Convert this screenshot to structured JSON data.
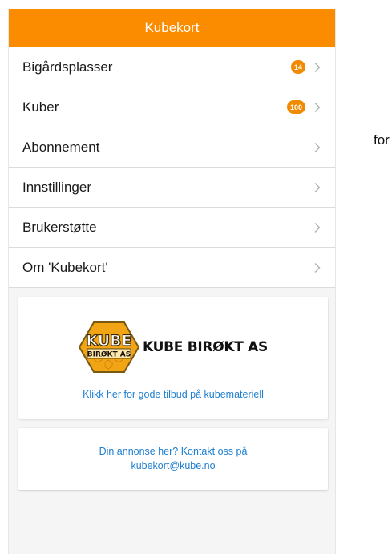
{
  "app": {
    "title": "Kubekort"
  },
  "menu": {
    "items": [
      {
        "label": "Bigårdsplasser",
        "badge": "14"
      },
      {
        "label": "Kuber",
        "badge": "100"
      },
      {
        "label": "Abonnement",
        "badge": null
      },
      {
        "label": "Innstillinger",
        "badge": null
      },
      {
        "label": "Brukerstøtte",
        "badge": null
      },
      {
        "label": "Om 'Kubekort'",
        "badge": null
      }
    ],
    "chevron_icon": "chevron-right-icon"
  },
  "sponsor": {
    "logo_badge_top": "KUBE",
    "logo_badge_bottom": "BIRØKT AS",
    "logo_text": "KUBE BIRØKT AS",
    "link": "Klikk her for gode tilbud på kubemateriell"
  },
  "ad": {
    "line1": "Din annonse her? Kontakt oss på",
    "line2": "kubekort@kube.no"
  },
  "side": {
    "text": "for"
  },
  "colors": {
    "appbar": "#fb8c00",
    "badge": "#f08a00",
    "link": "#1e7fd0"
  }
}
